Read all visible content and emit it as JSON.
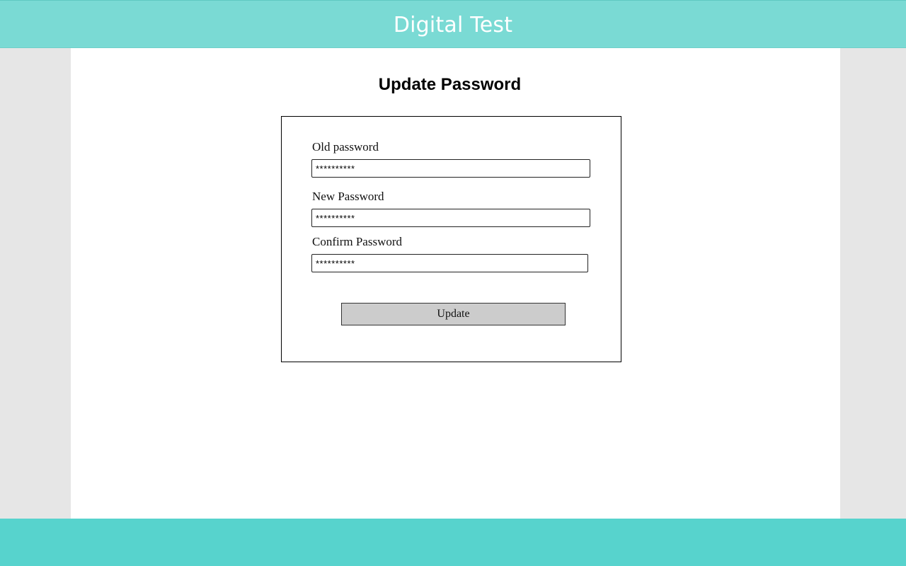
{
  "header": {
    "title": "Digital Test"
  },
  "page": {
    "title": "Update Password"
  },
  "form": {
    "fields": [
      {
        "label": "Old password",
        "value": "**********"
      },
      {
        "label": "New Password",
        "value": "**********"
      },
      {
        "label": "Confirm Password",
        "value": "**********"
      }
    ],
    "submit_label": "Update"
  },
  "colors": {
    "header_bg": "#7adad4",
    "footer_bg": "#57d3cd",
    "button_bg": "#cccccc",
    "page_bg": "#e6e6e6"
  }
}
